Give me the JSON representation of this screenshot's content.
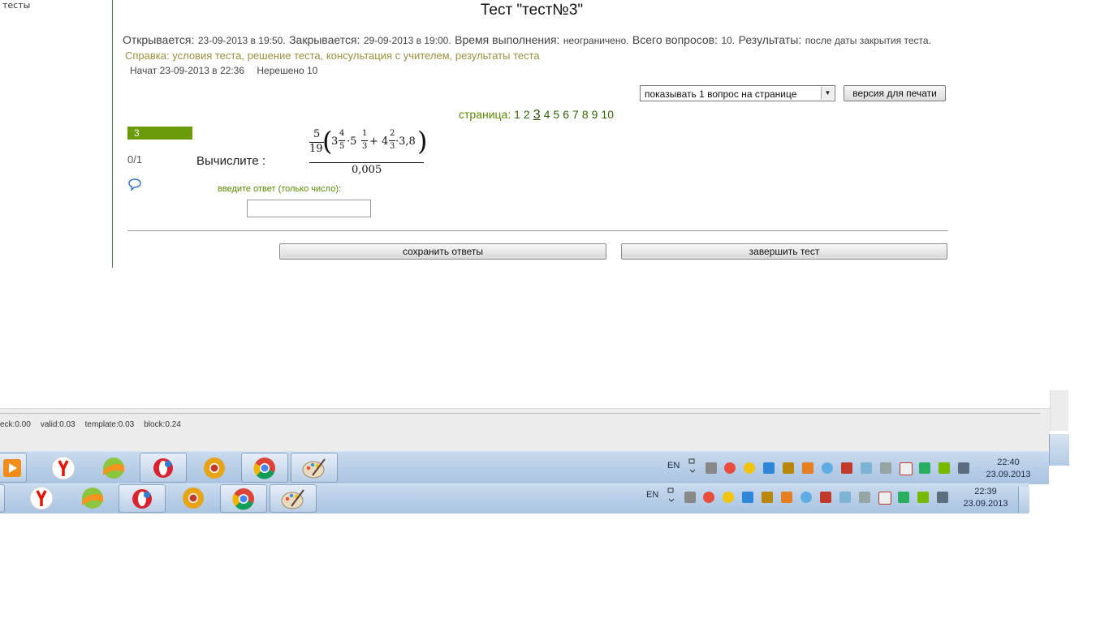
{
  "sidebar": {
    "link": "тесты"
  },
  "header": {
    "title": "Тест \"тест№3\""
  },
  "info": {
    "opens_label": "Открывается:",
    "opens_value": "23-09-2013 в 19:50.",
    "closes_label": "Закрывается:",
    "closes_value": "29-09-2013 в 19:00.",
    "time_label": "Время выполнения:",
    "time_value": "неограничено.",
    "total_label": "Всего вопросов:",
    "total_value": "10.",
    "results_label": "Результаты:",
    "results_value": "после даты закрытия теста."
  },
  "help": {
    "label": "Справка:",
    "links": [
      "условия теста,",
      "решение теста,",
      "консультация с учителем,",
      "результаты теста"
    ]
  },
  "status": {
    "started": "Начат 23-09-2013 в 22:36",
    "unsolved": "Нерешено 10"
  },
  "controls": {
    "per_page": "показывать 1 вопрос на странице",
    "print_label": "версия для печати"
  },
  "pager": {
    "label": "страница:",
    "pages": [
      "1",
      "2",
      "3",
      "4",
      "5",
      "6",
      "7",
      "8",
      "9",
      "10"
    ],
    "current": "3"
  },
  "question": {
    "number": "3",
    "score": "0/1",
    "prompt": "Вычислите :",
    "formula": {
      "frac_num": "5",
      "frac_den": "19",
      "t1_whole": "3",
      "t1_num": "4",
      "t1_den": "5",
      "dot1": "·5",
      "t2_num": "1",
      "t2_den": "3",
      "plus": "+ 4",
      "t3_num": "2",
      "t3_den": "3",
      "tail": "·3,8",
      "denominator": "0,005"
    },
    "answer_label": "введите ответ (только число):",
    "answer_value": ""
  },
  "buttons": {
    "save": "сохранить ответы",
    "finish": "завершить тест"
  },
  "debug": [
    "eck:0.00",
    "valid:0.03",
    "template:0.03",
    "block:0.24"
  ],
  "taskbar1": {
    "lang": "EN",
    "time": "22:40",
    "date": "23.09.2013"
  },
  "taskbar2": {
    "lang": "EN",
    "time": "22:39",
    "date": "23.09.2013"
  },
  "icons": [
    "media-player-icon",
    "yandex-browser-icon",
    "pinball-icon",
    "opera-icon",
    "chrome-canary-icon",
    "chrome-icon",
    "paint-icon"
  ],
  "colors": {
    "accent": "#6b9a0a",
    "help": "#9a8f3c",
    "taskbar": "#b8cfe8"
  }
}
